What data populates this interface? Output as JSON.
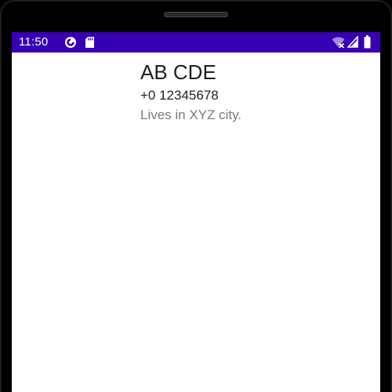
{
  "status_bar": {
    "time": "11:50",
    "background_color": "#3700b3",
    "left_icons": [
      "data-saver-icon",
      "sd-card-icon"
    ],
    "right_icons": [
      "wifi-off-icon",
      "cell-signal-icon",
      "battery-icon"
    ]
  },
  "profile": {
    "name": "AB CDE",
    "phone": "+0 12345678",
    "address": "Lives in XYZ city."
  }
}
